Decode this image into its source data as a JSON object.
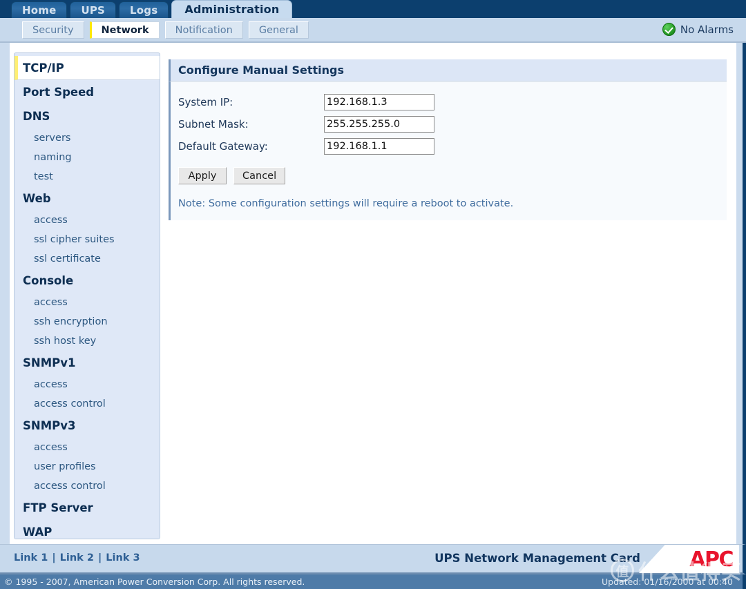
{
  "main_tabs": [
    {
      "label": "Home",
      "active": false
    },
    {
      "label": "UPS",
      "active": false
    },
    {
      "label": "Logs",
      "active": false
    },
    {
      "label": "Administration",
      "active": true
    }
  ],
  "sub_tabs": [
    {
      "label": "Security",
      "active": false
    },
    {
      "label": "Network",
      "active": true
    },
    {
      "label": "Notification",
      "active": false
    },
    {
      "label": "General",
      "active": false
    }
  ],
  "alarm_status": {
    "label": "No Alarms",
    "icon": "green-check-icon",
    "color": "#2aa02a"
  },
  "sidebar": {
    "items": [
      {
        "label": "TCP/IP",
        "type": "head",
        "selected": true
      },
      {
        "label": "Port Speed",
        "type": "head",
        "selected": false
      },
      {
        "label": "DNS",
        "type": "head",
        "selected": false
      },
      {
        "label": "servers",
        "type": "sub",
        "selected": false
      },
      {
        "label": "naming",
        "type": "sub",
        "selected": false
      },
      {
        "label": "test",
        "type": "sub",
        "selected": false
      },
      {
        "label": "Web",
        "type": "head",
        "selected": false
      },
      {
        "label": "access",
        "type": "sub",
        "selected": false
      },
      {
        "label": "ssl cipher suites",
        "type": "sub",
        "selected": false
      },
      {
        "label": "ssl certificate",
        "type": "sub",
        "selected": false
      },
      {
        "label": "Console",
        "type": "head",
        "selected": false
      },
      {
        "label": "access",
        "type": "sub",
        "selected": false
      },
      {
        "label": "ssh encryption",
        "type": "sub",
        "selected": false
      },
      {
        "label": "ssh host key",
        "type": "sub",
        "selected": false
      },
      {
        "label": "SNMPv1",
        "type": "head",
        "selected": false
      },
      {
        "label": "access",
        "type": "sub",
        "selected": false
      },
      {
        "label": "access control",
        "type": "sub",
        "selected": false
      },
      {
        "label": "SNMPv3",
        "type": "head",
        "selected": false
      },
      {
        "label": "access",
        "type": "sub",
        "selected": false
      },
      {
        "label": "user profiles",
        "type": "sub",
        "selected": false
      },
      {
        "label": "access control",
        "type": "sub",
        "selected": false
      },
      {
        "label": "FTP Server",
        "type": "head",
        "selected": false
      },
      {
        "label": "WAP",
        "type": "head",
        "selected": false
      }
    ]
  },
  "panel": {
    "title": "Configure Manual Settings",
    "fields": [
      {
        "label": "System IP:",
        "value": "192.168.1.3",
        "name": "system-ip"
      },
      {
        "label": "Subnet Mask:",
        "value": "255.255.255.0",
        "name": "subnet-mask"
      },
      {
        "label": "Default Gateway:",
        "value": "192.168.1.1",
        "name": "default-gateway"
      }
    ],
    "apply_label": "Apply",
    "cancel_label": "Cancel",
    "note": "Note: Some configuration settings will require a reboot to activate."
  },
  "footer": {
    "links": [
      "Link 1",
      "Link 2",
      "Link 3"
    ],
    "separator": "|",
    "product_name": "UPS Network Management Card",
    "logo_text": "APC",
    "copyright": "© 1995 - 2007, American Power Conversion Corp. All rights reserved.",
    "updated": "Updated: 01/16/2000 at 00:40"
  },
  "watermark": {
    "badge": "值",
    "text": "什么值得买"
  }
}
